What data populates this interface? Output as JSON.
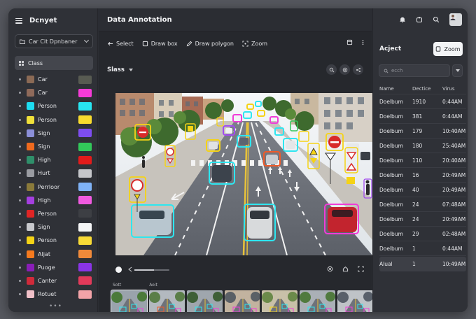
{
  "sidebar": {
    "title": "Dcnyet",
    "project_select": "Car Cit Dpnbaner",
    "section_header": "Class",
    "more": "•••",
    "classes": [
      {
        "label": "Car",
        "c1": "#8b6a55",
        "c2": "#585b52"
      },
      {
        "label": "Car",
        "c1": "#8f6a5a",
        "c2": "#f53bd7"
      },
      {
        "label": "Person",
        "c1": "#1ddcf0",
        "c2": "#28e6f2"
      },
      {
        "label": "Person",
        "c1": "#f0e03a",
        "c2": "#f8db2e"
      },
      {
        "label": "Sign",
        "c1": "#8b8fd8",
        "c2": "#7d4df0"
      },
      {
        "label": "Sign",
        "c1": "#f06a1e",
        "c2": "#32c85a"
      },
      {
        "label": "High",
        "c1": "#2f8f6a",
        "c2": "#e21b1b"
      },
      {
        "label": "Hurt",
        "c1": "#9a9ca2",
        "c2": "#c5c6ca"
      },
      {
        "label": "Perrloor",
        "c1": "#8a7a3a",
        "c2": "#7fb2f6"
      },
      {
        "label": "High",
        "c1": "#a53fe0",
        "c2": "#f05ae0"
      },
      {
        "label": "Person",
        "c1": "#e02525",
        "c2": "#3d3f44"
      },
      {
        "label": "Sign",
        "c1": "#c8c9cd",
        "c2": "#f5f6f7"
      },
      {
        "label": "Person",
        "c1": "#f5d316",
        "c2": "#f8da36"
      },
      {
        "label": "Aljat",
        "c1": "#f57a1e",
        "c2": "#f08a3a"
      },
      {
        "label": "Puoge",
        "c1": "#8a1eb8",
        "c2": "#8a34e6"
      },
      {
        "label": "Canter",
        "c1": "#d02a3a",
        "c2": "#e23a5a"
      },
      {
        "label": "Rotuet",
        "c1": "#f0c0c8",
        "c2": "#f3a3a8"
      }
    ]
  },
  "main": {
    "title": "Data Annotation",
    "tools": [
      "Select",
      "Draw box",
      "Draw polygon",
      "Zoom"
    ],
    "class_dropdown": "Slass",
    "filmstrip_labels": [
      "Sott",
      "Aoit"
    ],
    "progress": 0.55
  },
  "right_panel": {
    "title": "Acject",
    "zoom_label": "Zoom",
    "search_placeholder": "ecch",
    "columns": [
      "Name",
      "Dectice",
      "Virus"
    ],
    "rows": [
      [
        "Doelbum",
        "1910",
        "0:44AM"
      ],
      [
        "Doelbum",
        "381",
        "0:44AM"
      ],
      [
        "Doelbum",
        "179",
        "10:40AM"
      ],
      [
        "Doelbum",
        "180",
        "25:40AM"
      ],
      [
        "Doelbum",
        "110",
        "20:40AM"
      ],
      [
        "Doelbum",
        "16",
        "20:49AM"
      ],
      [
        "Doelbum",
        "40",
        "20:49AM"
      ],
      [
        "Doelbum",
        "24",
        "07:48AM"
      ],
      [
        "Doelbum",
        "24",
        "20:49AM"
      ],
      [
        "Doelbum",
        "29",
        "02:48AM"
      ],
      [
        "Doelbum",
        "1",
        "0:44AM"
      ],
      [
        "Alual",
        "1",
        "10:49AM"
      ]
    ]
  },
  "colors": {
    "accent_cyan": "#2ee6f0",
    "accent_magenta": "#f03cd8",
    "accent_yellow": "#f5d316"
  }
}
